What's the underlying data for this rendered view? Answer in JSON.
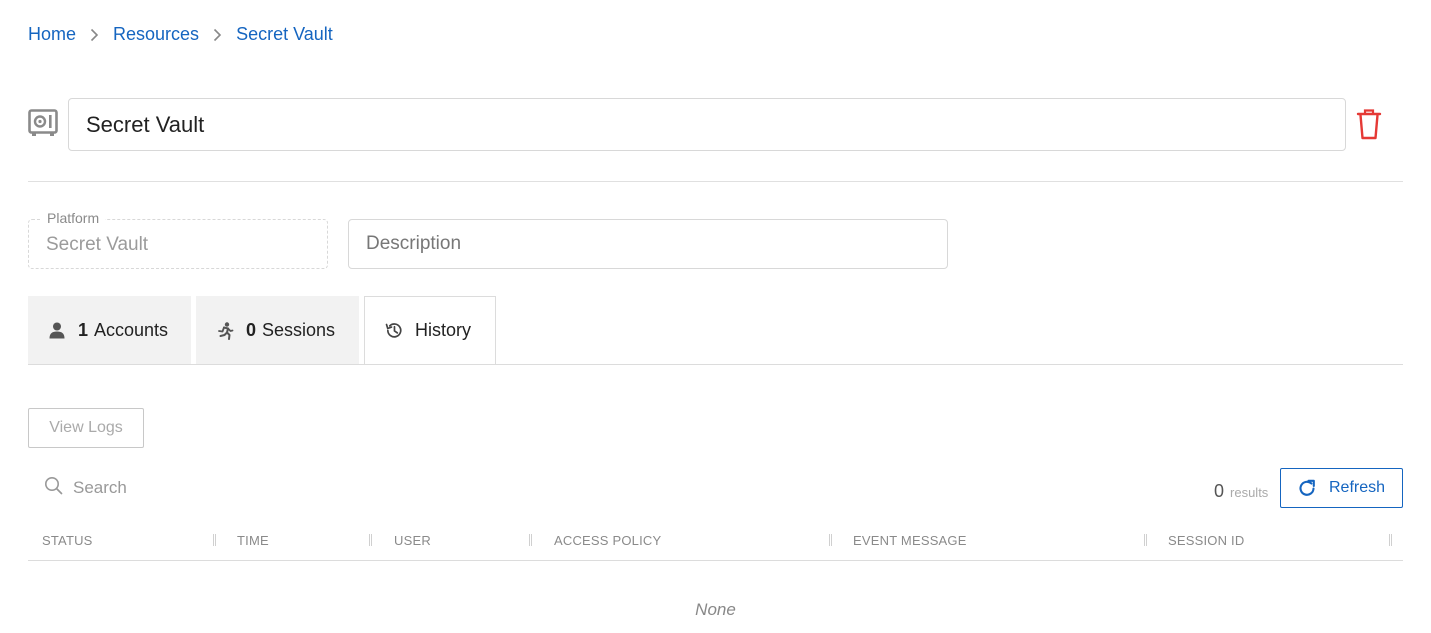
{
  "breadcrumb": [
    "Home",
    "Resources",
    "Secret Vault"
  ],
  "resource": {
    "name": "Secret Vault",
    "icon": "vault-icon"
  },
  "platform": {
    "label": "Platform",
    "value": "Secret Vault"
  },
  "description": {
    "placeholder": "Description",
    "value": ""
  },
  "tabs": [
    {
      "count": "1",
      "label": "Accounts",
      "icon": "user-icon",
      "active": false
    },
    {
      "count": "0",
      "label": "Sessions",
      "icon": "running-person-icon",
      "active": false
    },
    {
      "count": "",
      "label": "History",
      "icon": "history-icon",
      "active": true
    }
  ],
  "toolbar": {
    "view_logs_label": "View Logs",
    "search_placeholder": "Search",
    "results_count": "0",
    "results_label": "results",
    "refresh_label": "Refresh"
  },
  "table": {
    "columns": [
      "STATUS",
      "TIME",
      "USER",
      "ACCESS POLICY",
      "EVENT MESSAGE",
      "SESSION ID"
    ],
    "rows": [],
    "empty_text": "None"
  },
  "colors": {
    "accent": "#1565c0",
    "danger": "#e53935",
    "tab_inactive_bg": "#f2f2f2"
  }
}
